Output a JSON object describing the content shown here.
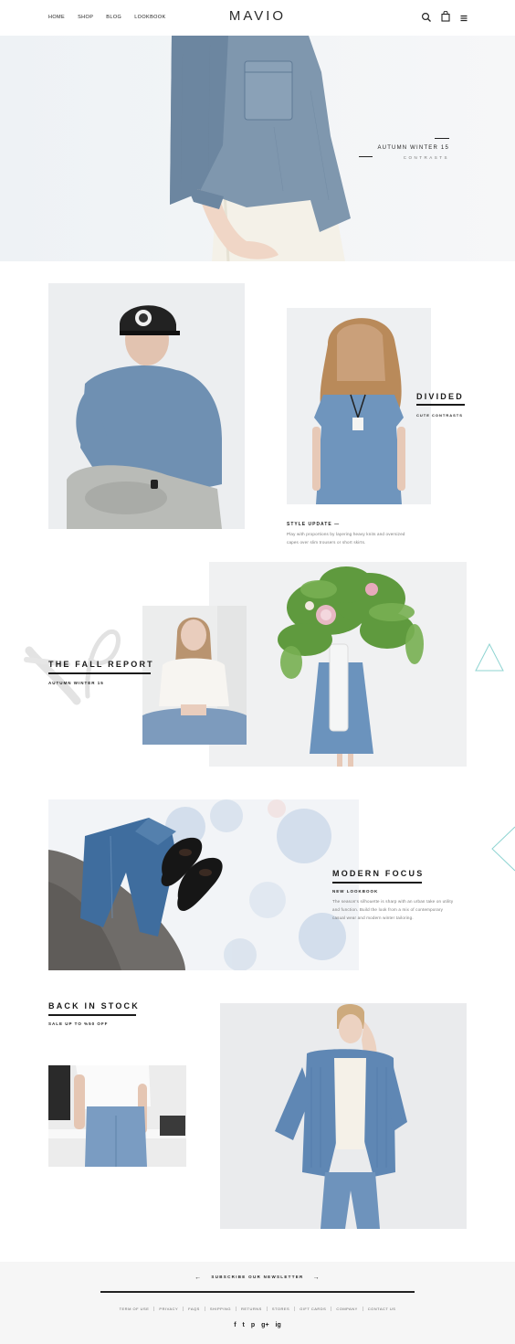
{
  "header": {
    "nav": [
      "HOME",
      "SHOP",
      "BLOG",
      "LOOKBOOK"
    ],
    "logo": "MAVIO"
  },
  "hero": {
    "title": "AUTUMN WINTER 15",
    "subtitle": "CONTRASTS"
  },
  "divided": {
    "title": "DIVIDED",
    "subtitle": "CUTE CONTRASTS",
    "style_title": "STYLE UPDATE —",
    "style_text_1": "Play with proportions by layering heavy knits and oversized",
    "style_text_2": "capes over slim trousers or short skirts."
  },
  "fall_report": {
    "title": "THE FALL REPORT",
    "subtitle": "AUTUMN WINTER 15"
  },
  "modern_focus": {
    "title": "MODERN FOCUS",
    "subtitle": "NEW LOOKBOOK",
    "text_1": "The season's silhouette is sharp with an urban take on utility",
    "text_2": "and function. Build the look from a mix of contemporary",
    "text_3": "casual wear and modern winter tailoring."
  },
  "back_in_stock": {
    "title": "BACK IN STOCK",
    "subtitle": "SALE UP TO %50 OFF"
  },
  "footer": {
    "newsletter": "SUBSCRIBE OUR NEWSLETTER",
    "links": [
      "TERM OF USE",
      "PRIVACY",
      "FAQS",
      "SHIPPING",
      "RETURNS",
      "STORES",
      "GIFT CARDS",
      "COMPANY",
      "CONTACT US"
    ],
    "social": [
      "f",
      "t",
      "p",
      "g+",
      "ig"
    ]
  },
  "colors": {
    "denim": "#6f8ba6",
    "accent_teal": "#8fd4d2",
    "text": "#1c1c1c"
  }
}
